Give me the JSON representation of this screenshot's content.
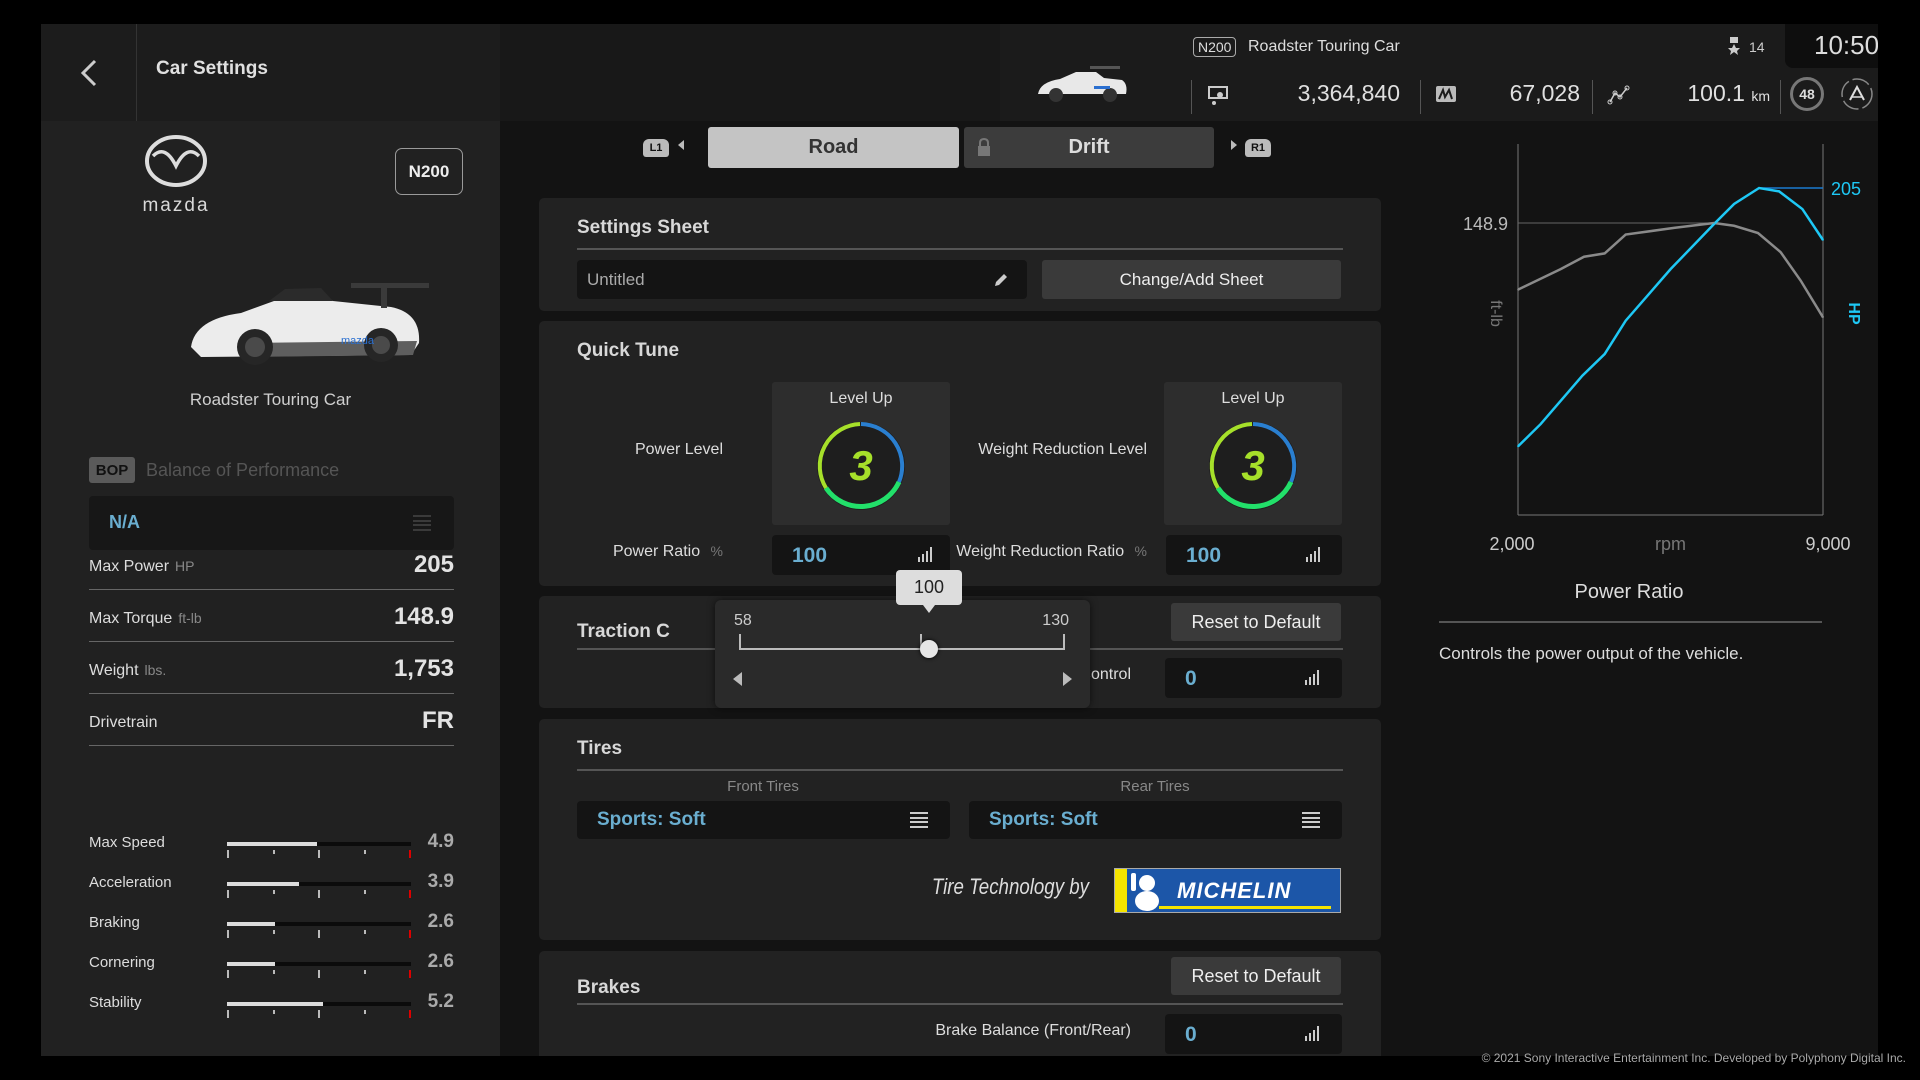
{
  "header": {
    "back_label": "Back",
    "title": "Car Settings",
    "car_class": "N200",
    "car_name": "Roadster Touring Car",
    "credits": "3,364,840",
    "mileage_points": "67,028",
    "distance": "100.1",
    "distance_unit": "km",
    "level": "48",
    "notifications": "14",
    "time": "10:50"
  },
  "left_panel": {
    "manufacturer": "mazda",
    "class_badge": "N200",
    "car_name": "Roadster Touring Car",
    "bop_tag": "BOP",
    "bop_label": "Balance of Performance",
    "bop_value": "N/A",
    "specs": [
      {
        "label": "Max Power",
        "unit": "HP",
        "value": "205"
      },
      {
        "label": "Max Torque",
        "unit": "ft-lb",
        "value": "148.9"
      },
      {
        "label": "Weight",
        "unit": "lbs.",
        "value": "1,753"
      },
      {
        "label": "Drivetrain",
        "unit": "",
        "value": "FR"
      }
    ],
    "performance": [
      {
        "label": "Max Speed",
        "value": "4.9",
        "ratio": 0.49
      },
      {
        "label": "Acceleration",
        "value": "3.9",
        "ratio": 0.39
      },
      {
        "label": "Braking",
        "value": "2.6",
        "ratio": 0.26
      },
      {
        "label": "Cornering",
        "value": "2.6",
        "ratio": 0.26
      },
      {
        "label": "Stability",
        "value": "5.2",
        "ratio": 0.52
      }
    ]
  },
  "tabs": {
    "left_button": "L1",
    "right_button": "R1",
    "items": [
      {
        "label": "Road",
        "active": true,
        "locked": false
      },
      {
        "label": "Drift",
        "active": false,
        "locked": true
      }
    ]
  },
  "settings_sheet": {
    "title": "Settings Sheet",
    "name_value": "Untitled",
    "change_button": "Change/Add Sheet"
  },
  "quick_tune": {
    "title": "Quick Tune",
    "power_level_label": "Power Level",
    "power_level_card_label": "Level Up",
    "power_level_value": "3",
    "weight_level_label": "Weight Reduction Level",
    "weight_level_card_label": "Level Up",
    "weight_level_value": "3",
    "power_ratio_label": "Power Ratio",
    "power_ratio_unit": "%",
    "power_ratio_value": "100",
    "weight_ratio_label": "Weight Reduction Ratio",
    "weight_ratio_unit": "%",
    "weight_ratio_value": "100"
  },
  "slider_popup": {
    "min": "58",
    "max": "130",
    "current": "100",
    "default_fraction": 0.5556,
    "value_fraction": 0.5833
  },
  "traction": {
    "title": "Traction Control",
    "title_visible": "Traction C",
    "reset_button": "Reset to Default",
    "row_label": "Traction Control",
    "row_label_visible": "raction Control",
    "value": "0"
  },
  "tires": {
    "title": "Tires",
    "front_label": "Front Tires",
    "front_value": "Sports: Soft",
    "rear_label": "Rear Tires",
    "rear_value": "Sports: Soft",
    "sponsor_text": "Tire Technology by",
    "sponsor_brand": "MICHELIN"
  },
  "brakes": {
    "title": "Brakes",
    "reset_button": "Reset to Default",
    "row_label": "Brake Balance (Front/Rear)",
    "value": "0"
  },
  "info": {
    "title": "Power Ratio",
    "description": "Controls the power output of the vehicle."
  },
  "footer": "© 2021 Sony Interactive Entertainment Inc. Developed by Polyphony Digital Inc.",
  "colors": {
    "accent_value": "#6aaed0",
    "hp_curve": "#1ec8f5",
    "torque_curve": "#8a8a8a",
    "level_green": "#9be01e"
  },
  "chart_data": {
    "type": "line",
    "title": "",
    "xlabel": "rpm",
    "ylabel_left": "ft-lb",
    "ylabel_right": "HP",
    "x_ticks": [
      "2,000",
      "9,000"
    ],
    "xlim": [
      2000,
      9000
    ],
    "y_left_marker": "148.9",
    "y_right_marker": "205",
    "ylim_left": [
      0,
      148.9
    ],
    "ylim_right": [
      0,
      205
    ],
    "grid": false,
    "series": [
      {
        "name": "Torque (ft-lb)",
        "axis": "left",
        "x": [
          2000,
          2979,
          3515,
          3989,
          4471,
          5580,
          6500,
          6959,
          7508,
          8029,
          8488,
          9000
        ],
        "y": [
          114.9,
          125.4,
          131.7,
          133.4,
          143.0,
          146.4,
          148.9,
          147.5,
          143.8,
          134.0,
          119.5,
          100.8
        ]
      },
      {
        "name": "Power (HP)",
        "axis": "right",
        "x": [
          2000,
          2520,
          3476,
          3989,
          4471,
          5504,
          6500,
          6959,
          7533,
          7992,
          8527,
          9000
        ],
        "y": [
          43,
          57,
          87.3,
          100.9,
          121.8,
          154.2,
          182.4,
          195,
          205,
          202.9,
          191.8,
          172.4
        ]
      }
    ]
  }
}
